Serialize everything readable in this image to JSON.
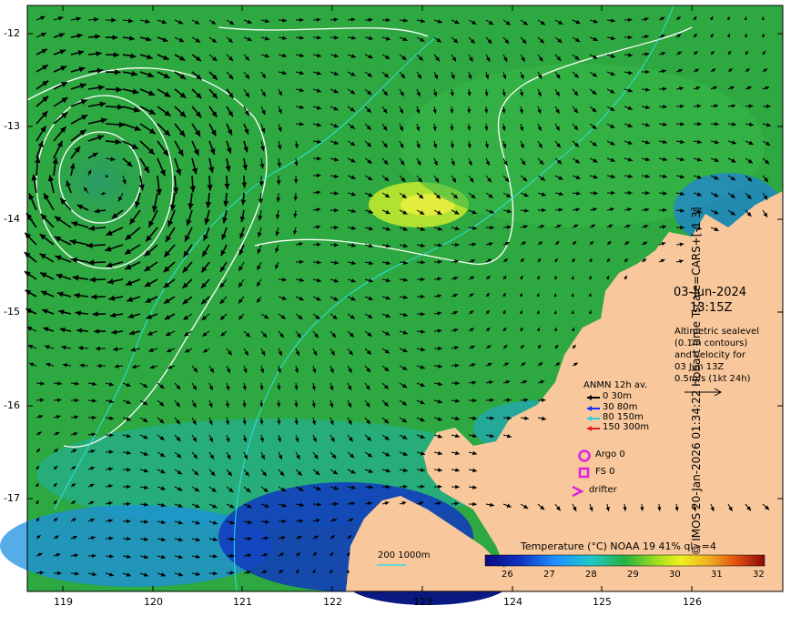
{
  "map": {
    "lat_ticks": [
      "-12",
      "-13",
      "-14",
      "-15",
      "-16",
      "-17"
    ],
    "lon_ticks": [
      "119",
      "120",
      "121",
      "122",
      "123",
      "124",
      "125",
      "126"
    ],
    "date": "03-Jun-2024",
    "time": "13:15Z",
    "altimetry_lines": [
      "Altimetric sealevel",
      "(0.1m contours)",
      "and velocity for",
      "03 Jun 13Z",
      "0.5m/s (1kt 24h)"
    ],
    "anmn": {
      "title": "ANMN 12h av.",
      "items": [
        {
          "label": "0 30m",
          "color": "#000000"
        },
        {
          "label": "30 80m",
          "color": "#1a2cff"
        },
        {
          "label": "80 150m",
          "color": "#2ad0e0"
        },
        {
          "label": "150 300m",
          "color": "#e52020"
        }
      ]
    },
    "argo_label": "Argo 0",
    "fs_label": "FS 0",
    "drifter_label": "drifter",
    "depth_legend": "200  1000m",
    "colorbar_title": "Temperature (°C) NOAA 19 41% ql>=4",
    "colorbar_ticks": [
      "26",
      "27",
      "28",
      "29",
      "30",
      "31",
      "32"
    ],
    "credit": "© IMOS 20-Jan-2026 01:34:22 Hobart time Tscale=CARS+[-1 3]",
    "colors": {
      "land": "#f8c89c",
      "marker": "#e020e0",
      "water_green": "#2ea840"
    }
  }
}
